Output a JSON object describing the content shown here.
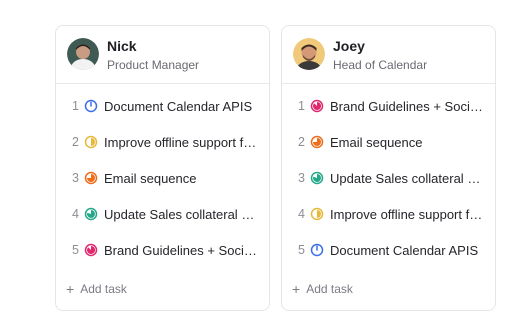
{
  "colors": {
    "blue": "#3b6ee6",
    "yellow": "#e8b83a",
    "orange": "#ef6c1b",
    "green": "#23a88a",
    "pink": "#e0286f"
  },
  "cards": [
    {
      "name": "Nick",
      "role": "Product Manager",
      "tasks": [
        {
          "num": "1",
          "title": "Document Calendar APIS",
          "status": "blue"
        },
        {
          "num": "2",
          "title": "Improve offline support for the app",
          "status": "yellow"
        },
        {
          "num": "3",
          "title": "Email sequence",
          "status": "orange"
        },
        {
          "num": "4",
          "title": "Update Sales collateral material",
          "status": "green"
        },
        {
          "num": "5",
          "title": "Brand Guidelines + Social assets",
          "status": "pink"
        }
      ],
      "add_label": "Add task"
    },
    {
      "name": "Joey",
      "role": "Head of Calendar",
      "tasks": [
        {
          "num": "1",
          "title": "Brand Guidelines + Social assets",
          "status": "pink"
        },
        {
          "num": "2",
          "title": "Email sequence",
          "status": "orange"
        },
        {
          "num": "3",
          "title": "Update Sales collateral material",
          "status": "green"
        },
        {
          "num": "4",
          "title": "Improve offline support for the app",
          "status": "yellow"
        },
        {
          "num": "5",
          "title": "Document Calendar APIS",
          "status": "blue"
        }
      ],
      "add_label": "Add task"
    }
  ]
}
